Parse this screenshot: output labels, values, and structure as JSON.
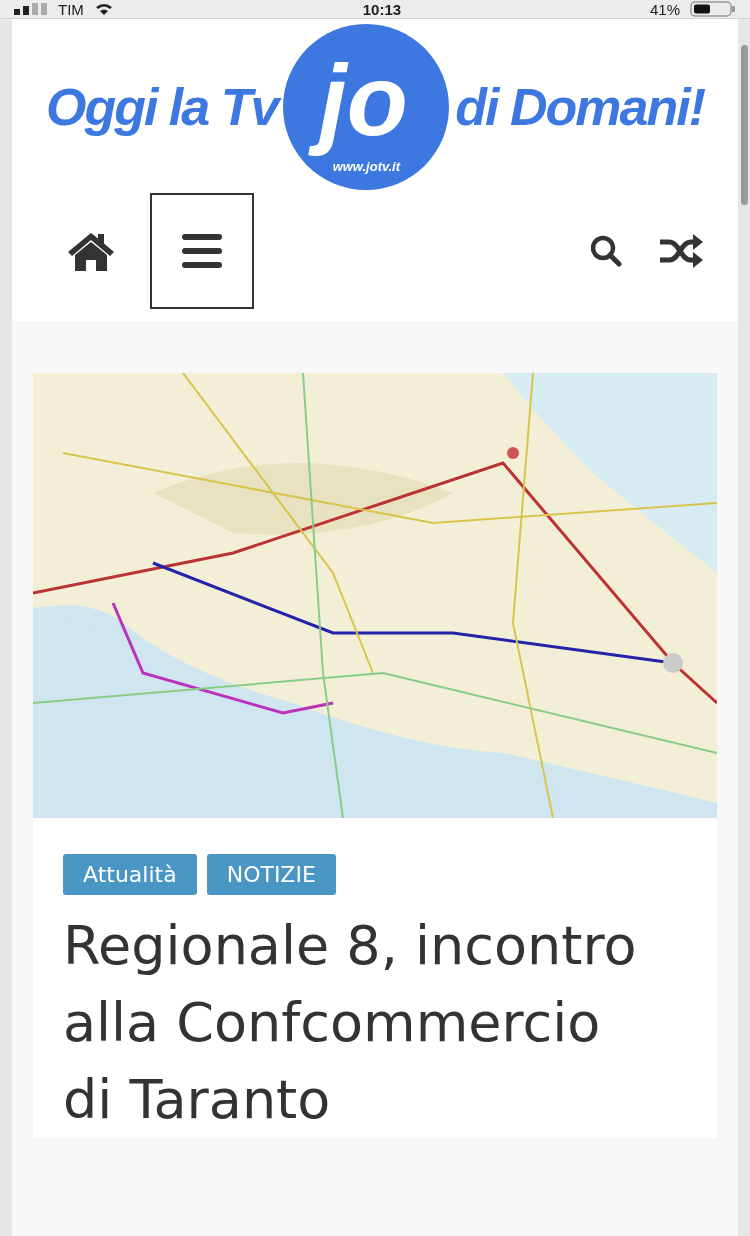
{
  "status_bar": {
    "carrier": "TIM",
    "time": "10:13",
    "battery": "41%"
  },
  "logo": {
    "left": "Oggi la Tv",
    "mark": "jo",
    "url": "www.jotv.it",
    "right": "di Domani!"
  },
  "nav": {
    "menu_open": false
  },
  "article": {
    "categories": [
      {
        "label": "Attualità"
      },
      {
        "label": "NOTIZIE"
      }
    ],
    "title": "Regionale 8, incontro alla Confcommercio di Taranto"
  }
}
